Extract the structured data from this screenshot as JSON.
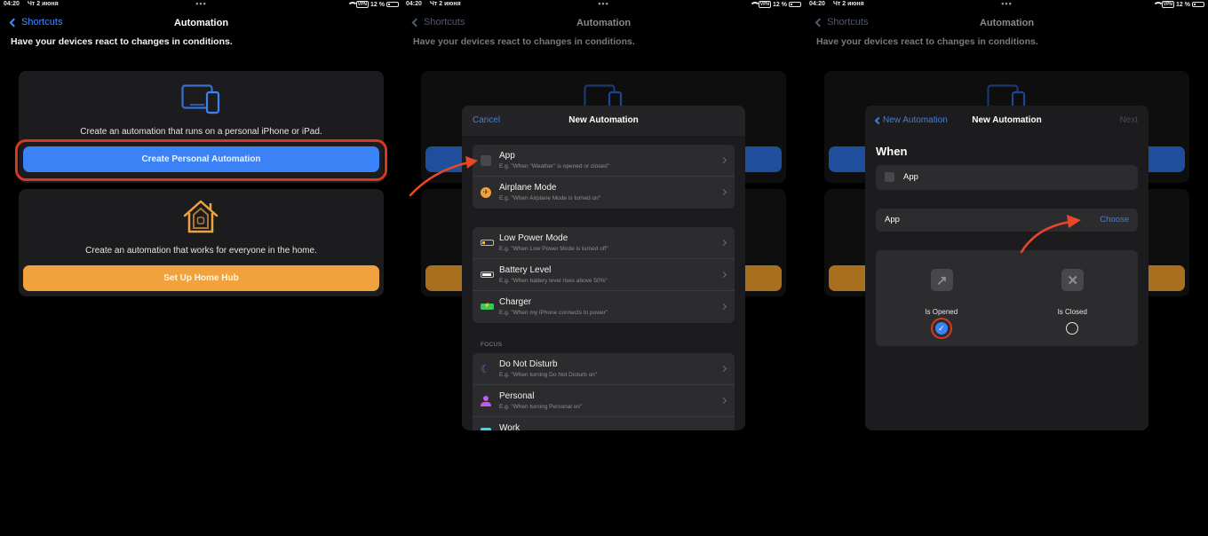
{
  "status_bar": {
    "time": "04:20",
    "date": "Чт 2 июня",
    "dots": "•••",
    "vpn": "VPN",
    "battery": "12 %"
  },
  "nav": {
    "back_label": "Shortcuts",
    "title": "Automation"
  },
  "subtitle": "Have your devices react to changes in conditions.",
  "personal_card": {
    "description": "Create an automation that runs on a personal iPhone or iPad.",
    "button_label": "Create Personal Automation"
  },
  "home_card": {
    "description": "Create an automation that works for everyone in the home.",
    "button_label": "Set Up Home Hub"
  },
  "new_automation_sheet": {
    "cancel_label": "Cancel",
    "title": "New Automation",
    "groups": [
      [
        {
          "label": "App",
          "example": "E.g. \"When \"Weather\" is opened or closed\"",
          "icon": "app-icon"
        },
        {
          "label": "Airplane Mode",
          "example": "E.g. \"When Airplane Mode is turned on\"",
          "icon": "airplane-icon"
        }
      ],
      [
        {
          "label": "Low Power Mode",
          "example": "E.g. \"When Low Power Mode is turned off\"",
          "icon": "low-battery-icon"
        },
        {
          "label": "Battery Level",
          "example": "E.g. \"When battery level rises above 50%\"",
          "icon": "battery-icon"
        },
        {
          "label": "Charger",
          "example": "E.g. \"When my iPhone connects to power\"",
          "icon": "charger-icon"
        }
      ],
      [
        {
          "label": "Do Not Disturb",
          "example": "E.g. \"When turning Do Not Disturb on\"",
          "icon": "moon-icon"
        },
        {
          "label": "Personal",
          "example": "E.g. \"When turning Personal on\"",
          "icon": "person-icon"
        },
        {
          "label": "Work",
          "example": "",
          "icon": "work-icon"
        }
      ]
    ],
    "focus_section_label": "FOCUS"
  },
  "app_sheet": {
    "back_label": "New Automation",
    "title": "New Automation",
    "next_label": "Next",
    "when_label": "When",
    "trigger_label": "App",
    "app_row_label": "App",
    "choose_label": "Choose",
    "options": [
      {
        "label": "Is Opened",
        "selected": true
      },
      {
        "label": "Is Closed",
        "selected": false
      }
    ]
  },
  "colors": {
    "accent_blue": "#3a82f6",
    "accent_orange": "#f0a23c",
    "highlight_red": "#d9381e"
  }
}
